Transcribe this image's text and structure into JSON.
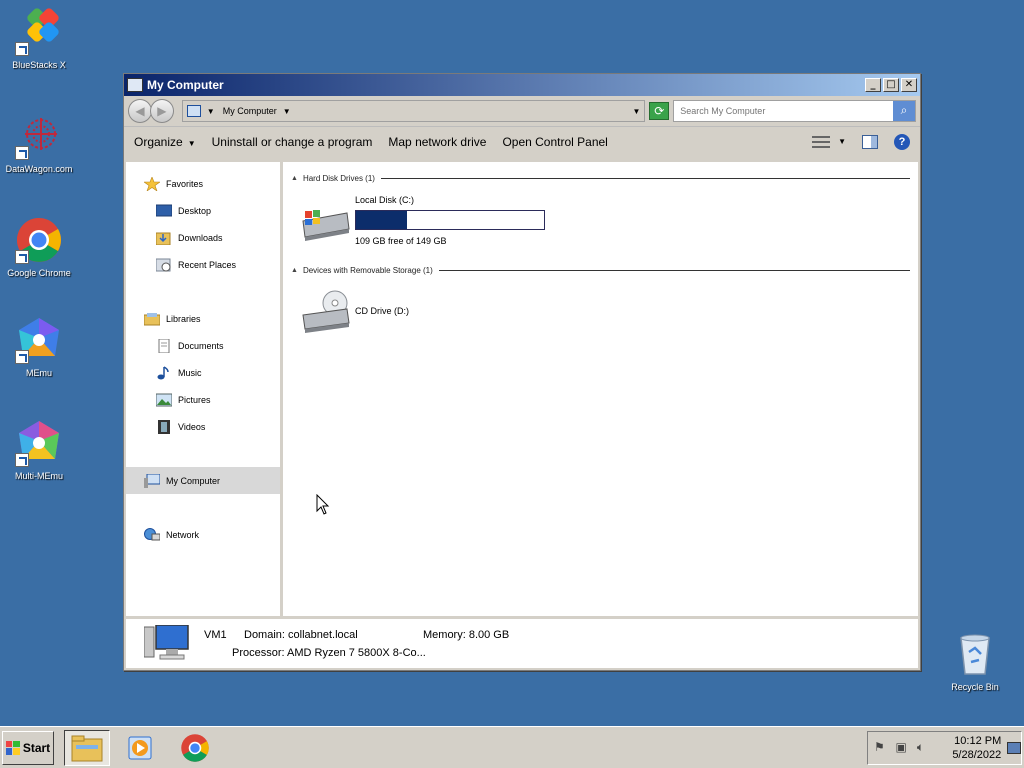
{
  "desktop": {
    "icons": [
      {
        "label": "BlueStacks X"
      },
      {
        "label": "DataWagon.com"
      },
      {
        "label": "Google Chrome"
      },
      {
        "label": "MEmu"
      },
      {
        "label": "Multi-MEmu"
      },
      {
        "label": "Recycle Bin"
      }
    ]
  },
  "window": {
    "title": "My Computer",
    "controls": {
      "minimize": "_",
      "maximize": "□",
      "close": "✕"
    },
    "address": {
      "path": "My Computer"
    },
    "search": {
      "placeholder": "Search My Computer"
    },
    "toolbar": {
      "organize": "Organize",
      "uninstall": "Uninstall or change a program",
      "map_drive": "Map network drive",
      "control_panel": "Open Control Panel",
      "help": "?"
    },
    "nav": {
      "favorites": "Favorites",
      "desktop": "Desktop",
      "downloads": "Downloads",
      "recent": "Recent Places",
      "libraries": "Libraries",
      "documents": "Documents",
      "music": "Music",
      "pictures": "Pictures",
      "videos": "Videos",
      "my_computer": "My Computer",
      "network": "Network"
    },
    "groups": {
      "hard_disk": "Hard Disk Drives (1)",
      "removable": "Devices with Removable Storage (1)"
    },
    "drives": {
      "local": {
        "name": "Local Disk (C:)",
        "free_text": "109 GB free of 149 GB",
        "used_fraction": 0.27
      },
      "cd": {
        "name": "CD Drive (D:)"
      }
    },
    "details": {
      "name": "VM1",
      "domain": "Domain: collabnet.local",
      "memory": "Memory: 8.00 GB",
      "processor": "Processor: AMD Ryzen 7 5800X 8-Co..."
    }
  },
  "taskbar": {
    "start": "Start",
    "clock_time": "10:12 PM",
    "clock_date": "5/28/2022"
  },
  "colors": {
    "desktop": "#3a6ea5",
    "drive_fill": "#0c2d6b"
  }
}
